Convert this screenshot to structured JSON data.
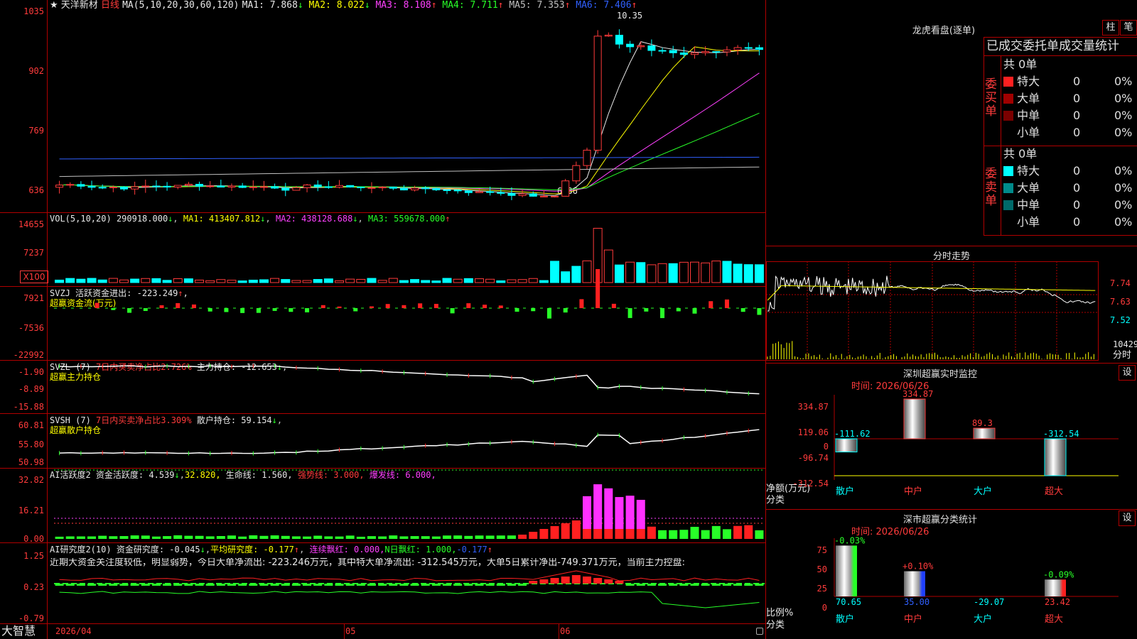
{
  "stock": {
    "star": "★",
    "name": "天洋新材",
    "period": "日线"
  },
  "main": {
    "ma_head": "MA(5,10,20,30,60,120)",
    "mas": [
      {
        "label": "MA1:",
        "value": "7.868",
        "arrow": "↓",
        "color": "#e8e8e8"
      },
      {
        "label": "MA2:",
        "value": "8.022",
        "arrow": "↓",
        "color": "#ffff00"
      },
      {
        "label": "MA3:",
        "value": "8.108",
        "arrow": "↑",
        "color": "#ff40ff"
      },
      {
        "label": "MA4:",
        "value": "7.711",
        "arrow": "↑",
        "color": "#28ff28"
      },
      {
        "label": "MA5:",
        "value": "7.353",
        "arrow": "↑",
        "color": "#c0c0c0"
      },
      {
        "label": "MA6:",
        "value": "7.406",
        "arrow": "↑",
        "color": "#3060ff"
      }
    ],
    "y_labels": [
      "1035",
      "902",
      "769",
      "636"
    ],
    "high_label": "10.35",
    "low_label": "6.36"
  },
  "vol": {
    "head": "VOL(5,10,20)",
    "val": "290918.000",
    "ma1": "MA1: 413407.812",
    "ma2": "MA2: 438128.688",
    "ma3": "MA3: 559678.000",
    "y_labels": [
      "14655",
      "7237"
    ],
    "unit": "X100"
  },
  "svzj": {
    "head": "SVZJ  活跃资金进出:",
    "val": "-223.249",
    "sub": "超赢资金流(万元)",
    "y_labels": [
      "7921",
      "-7536",
      "-22992"
    ]
  },
  "svzl": {
    "head": "SVZL (7)",
    "ratio": "7日内买卖净占比2.726%",
    "hold": "主力持仓: -12.653",
    "sub": "超赢主力持仓",
    "y_labels": [
      "-1.90",
      "-8.89",
      "-15.88"
    ]
  },
  "svsh": {
    "head": "SVSH (7)",
    "ratio": "7日内买卖净占比3.309%",
    "hold": "散户持仓: 59.154",
    "sub": "超赢散户持仓",
    "y_labels": [
      "60.81",
      "55.80",
      "50.98"
    ]
  },
  "ai1": {
    "head": "AI活跃度2",
    "act": "资金活跃度: 4.539",
    "v2": "32.820,",
    "life": "生命线: 1.560,",
    "strong": "强势线: 3.000,",
    "burst": "爆发线: 6.000,",
    "y_labels": [
      "32.82",
      "16.21",
      "0.00"
    ]
  },
  "ai2": {
    "head": "AI研究度2(10)",
    "res": "资金研究度: -0.045",
    "avg": "平均研究度: -0.177",
    "cont": "连续飘红: 0.000,",
    "n": "N日飘红: 1.000,",
    "last": "-0.177",
    "comment": "近期大资金关注度较低，明显弱势，今日大单净流出: -223.246万元，其中特大单净流出: -312.545万元，大单5日累计净出-749.371万元，当前主力控盘:",
    "y_labels": [
      "1.25",
      "0.23",
      "-0.79"
    ]
  },
  "xaxis": {
    "brand": "大智慧",
    "date": "2026/04",
    "m5": "05",
    "m6": "06"
  },
  "lhb": {
    "title": "龙虎看盘(逐单)",
    "btn1": "柱",
    "btn2": "笔",
    "sub": "已成交委托单成交量统计",
    "buy": {
      "side": "委买单",
      "total": "共 0单",
      "rows": [
        {
          "n": "特大",
          "c": "#ff2020",
          "v": "0",
          "p": "0%"
        },
        {
          "n": "大单",
          "c": "#a00000",
          "v": "0",
          "p": "0%"
        },
        {
          "n": "中单",
          "c": "#7a0000",
          "v": "0",
          "p": "0%"
        },
        {
          "n": "小单",
          "c": "#000000",
          "v": "0",
          "p": "0%"
        }
      ]
    },
    "sell": {
      "side": "委卖单",
      "total": "共 0单",
      "rows": [
        {
          "n": "特大",
          "c": "#00ffff",
          "v": "0",
          "p": "0%"
        },
        {
          "n": "大单",
          "c": "#008a8a",
          "v": "0",
          "p": "0%"
        },
        {
          "n": "中单",
          "c": "#006a6a",
          "v": "0",
          "p": "0%"
        },
        {
          "n": "小单",
          "c": "#000000",
          "v": "0",
          "p": "0%"
        }
      ]
    }
  },
  "fenshi": {
    "title": "分时走势",
    "y_labels": [
      "7.74",
      "7.63",
      "7.52"
    ],
    "vol_label": "10429",
    "footer": "分时"
  },
  "sz": {
    "title": "深圳超赢实时监控",
    "btn": "设",
    "time": "时间: 2026/06/26",
    "y_labels": [
      "334.87",
      "119.06",
      "0",
      "-96.74",
      "-312.54"
    ],
    "net": "净额(万元)",
    "cls": "分类",
    "bars": [
      {
        "cat": "散户",
        "value": -111.62,
        "label": "-111.62"
      },
      {
        "cat": "中户",
        "value": 334.87,
        "label": "334.87"
      },
      {
        "cat": "大户",
        "value": 89.3,
        "label": "89.3"
      },
      {
        "cat": "超大",
        "value": -312.54,
        "label": "-312.54"
      }
    ]
  },
  "ss": {
    "title": "深市超赢分类统计",
    "btn": "设",
    "time": "时间: 2026/06/26",
    "y_labels": [
      "75",
      "50",
      "25",
      "0"
    ],
    "ratio": "比例%",
    "cls": "分类",
    "bars": [
      {
        "cat": "散户",
        "pct": 70.65,
        "bottom": "70.65",
        "top": "-0.03%"
      },
      {
        "cat": "中户",
        "pct": 35.0,
        "bottom": "35.00",
        "top": "+0.10%"
      },
      {
        "cat": "大户",
        "pct": 0,
        "bottom": "-29.07",
        "top": ""
      },
      {
        "cat": "超大",
        "pct": 23.42,
        "bottom": "23.42",
        "top": "-0.09%"
      }
    ]
  }
}
